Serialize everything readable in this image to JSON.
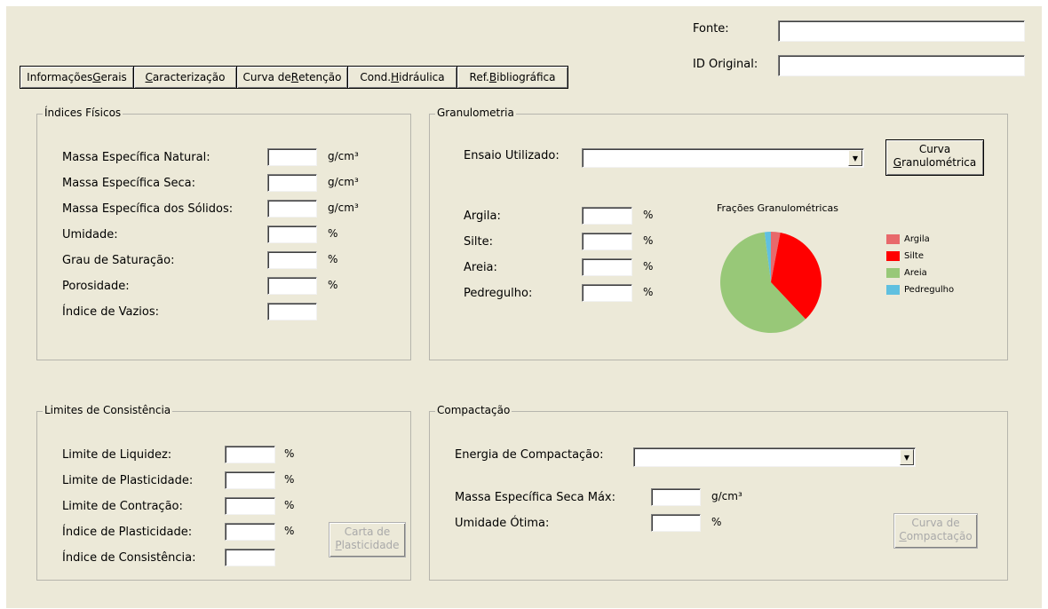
{
  "header": {
    "fonte_label": "Fonte:",
    "fonte_value": "",
    "id_label": "ID Original:",
    "id_value": ""
  },
  "tabs": [
    {
      "pre": "Informações ",
      "u": "G",
      "post": "erais"
    },
    {
      "pre": "",
      "u": "C",
      "post": "aracterização"
    },
    {
      "pre": "Curva de ",
      "u": "R",
      "post": "etenção"
    },
    {
      "pre": "Cond. ",
      "u": "H",
      "post": "idráulica"
    },
    {
      "pre": "Ref. ",
      "u": "B",
      "post": "ibliográfica"
    }
  ],
  "indices": {
    "title": "Índices Físicos",
    "rows": [
      {
        "label": "Massa Específica Natural:",
        "unit": "g/cm³",
        "value": ""
      },
      {
        "label": "Massa Específica Seca:",
        "unit": "g/cm³",
        "value": ""
      },
      {
        "label": "Massa Específica dos Sólidos:",
        "unit": "g/cm³",
        "value": ""
      },
      {
        "label": "Umidade:",
        "unit": "%",
        "value": ""
      },
      {
        "label": "Grau de Saturação:",
        "unit": "%",
        "value": ""
      },
      {
        "label": "Porosidade:",
        "unit": "%",
        "value": ""
      },
      {
        "label": "Índice de Vazios:",
        "unit": "",
        "value": ""
      }
    ]
  },
  "granulometria": {
    "title": "Granulometria",
    "ensaio_label": "Ensaio Utilizado:",
    "ensaio_value": "",
    "button": {
      "line1": "Curva",
      "line2_u": "G",
      "line2_rest": "ranulométrica"
    },
    "rows": [
      {
        "label": "Argila:",
        "unit": "%",
        "value": ""
      },
      {
        "label": "Silte:",
        "unit": "%",
        "value": ""
      },
      {
        "label": "Areia:",
        "unit": "%",
        "value": ""
      },
      {
        "label": "Pedregulho:",
        "unit": "%",
        "value": ""
      }
    ]
  },
  "limites": {
    "title": "Limites de Consistência",
    "rows": [
      {
        "label": "Limite de Liquidez:",
        "unit": "%",
        "value": ""
      },
      {
        "label": "Limite de Plasticidade:",
        "unit": "%",
        "value": ""
      },
      {
        "label": "Limite de Contração:",
        "unit": "%",
        "value": ""
      },
      {
        "label": "Índice de Plasticidade:",
        "unit": "%",
        "value": ""
      },
      {
        "label": "Índice de Consistência:",
        "unit": "",
        "value": ""
      }
    ],
    "button": {
      "line1": "Carta de",
      "line2_u": "P",
      "line2_rest": "lasticidade"
    }
  },
  "compactacao": {
    "title": "Compactação",
    "energia_label": "Energia de Compactação:",
    "energia_value": "",
    "rows": [
      {
        "label": "Massa Específica Seca Máx:",
        "unit": "g/cm³",
        "value": ""
      },
      {
        "label": "Umidade Ótima:",
        "unit": "%",
        "value": ""
      }
    ],
    "button": {
      "line1": "Curva de",
      "line2_u": "C",
      "line2_rest": "ompactação"
    }
  },
  "chart_data": {
    "type": "pie",
    "title": "Frações Granulométricas",
    "categories": [
      "Argila",
      "Silte",
      "Areia",
      "Pedregulho"
    ],
    "values": [
      3,
      35,
      60,
      2
    ],
    "colors": [
      "#e8696b",
      "#ff0000",
      "#98c878",
      "#60c0e0"
    ],
    "legend_position": "right"
  }
}
